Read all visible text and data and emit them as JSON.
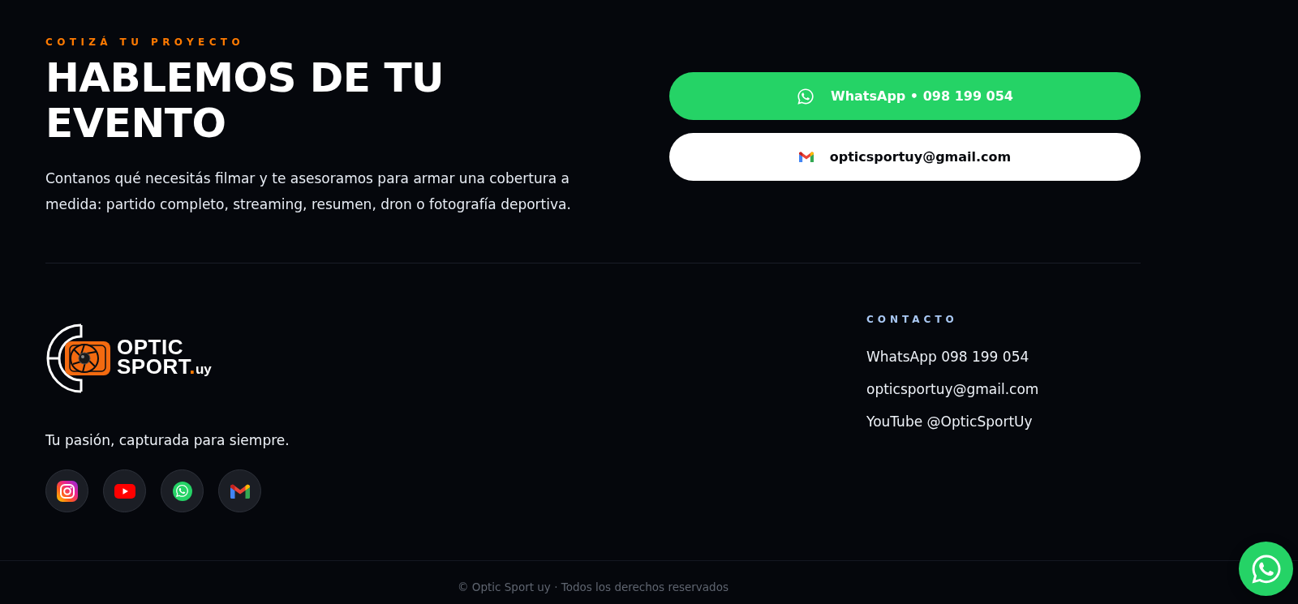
{
  "cta": {
    "eyebrow": "COTIZÁ TU PROYECTO",
    "title": "HABLEMOS DE TU EVENTO",
    "description": "Contanos qué necesitás filmar y te asesoramos para armar una cobertura a medida: partido completo, streaming, resumen, dron o fotografía deportiva.",
    "buttons": [
      {
        "kind": "whatsapp",
        "label": "WhatsApp • 098 199 054"
      },
      {
        "kind": "email",
        "label": "opticsportuy@gmail.com"
      }
    ]
  },
  "footer": {
    "logo": {
      "lines": [
        "OPTIC",
        "SPORT"
      ],
      "dot": ".",
      "suffix": "uy"
    },
    "tagline": "Tu pasión, capturada para siempre.",
    "social_links": [
      {
        "kind": "instagram"
      },
      {
        "kind": "youtube"
      },
      {
        "kind": "whatsapp"
      },
      {
        "kind": "email"
      }
    ],
    "contact": {
      "heading": "CONTACTO",
      "items": [
        "WhatsApp 098 199 054",
        "opticsportuy@gmail.com",
        "YouTube @OpticSportUy"
      ]
    },
    "copyright": "© Optic Sport uy · Todos los derechos reservados"
  },
  "floating_button": {
    "kind": "whatsapp"
  }
}
